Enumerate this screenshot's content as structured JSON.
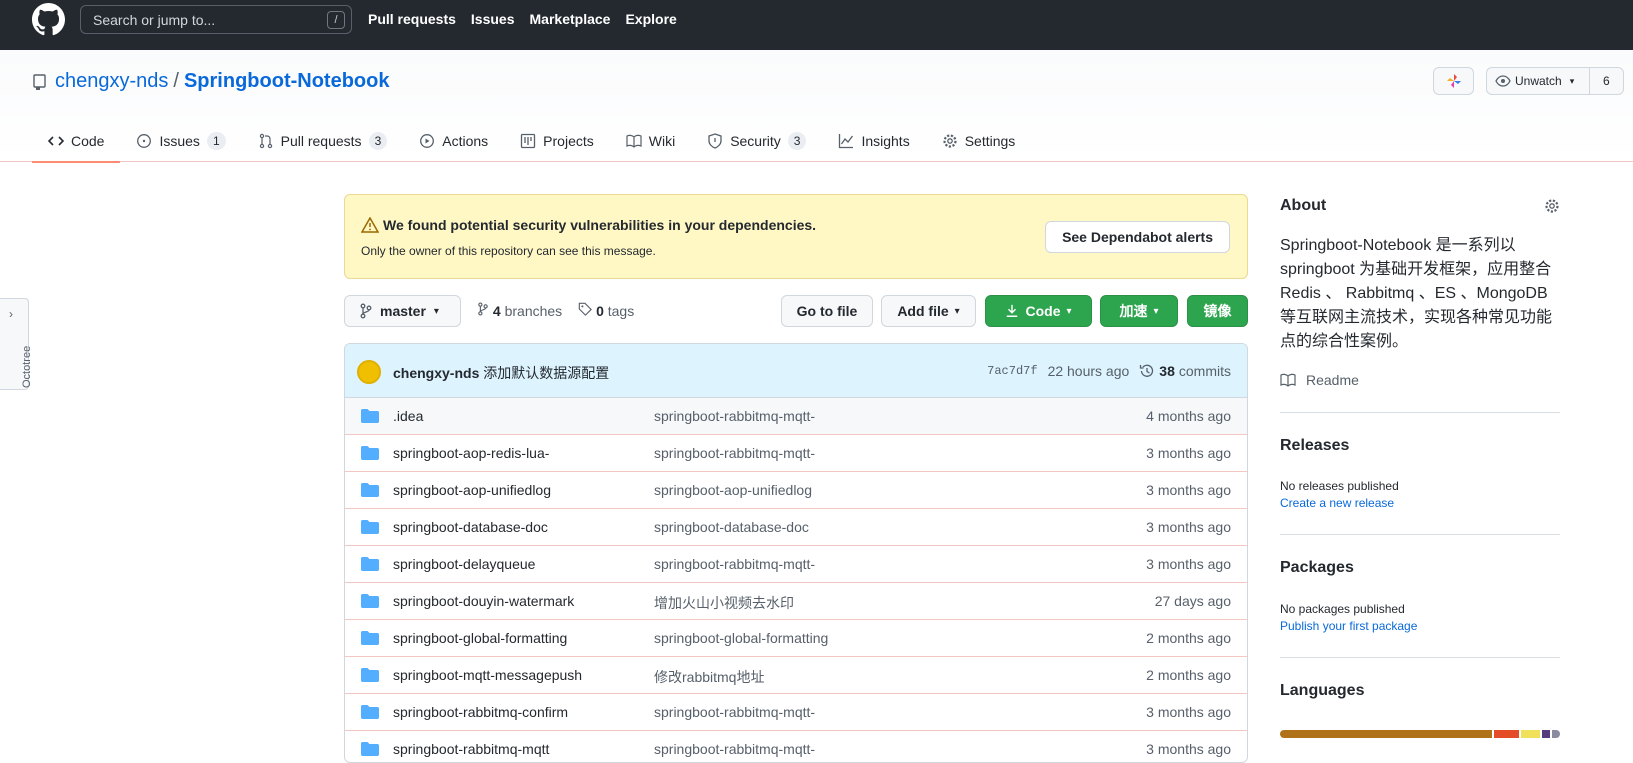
{
  "header": {
    "search_placeholder": "Search or jump to...",
    "search_shortcut": "/",
    "nav": [
      "Pull requests",
      "Issues",
      "Marketplace",
      "Explore"
    ]
  },
  "repo": {
    "owner": "chengxy-nds",
    "separator": "/",
    "name": "Springboot-Notebook",
    "watch_label": "Unwatch",
    "watch_count": "6"
  },
  "tabs": [
    {
      "label": "Code",
      "icon": "code-icon"
    },
    {
      "label": "Issues",
      "icon": "issue-icon",
      "count": "1"
    },
    {
      "label": "Pull requests",
      "icon": "pull-request-icon",
      "count": "3"
    },
    {
      "label": "Actions",
      "icon": "play-icon"
    },
    {
      "label": "Projects",
      "icon": "project-icon"
    },
    {
      "label": "Wiki",
      "icon": "book-icon"
    },
    {
      "label": "Security",
      "icon": "shield-icon",
      "count": "3"
    },
    {
      "label": "Insights",
      "icon": "graph-icon"
    },
    {
      "label": "Settings",
      "icon": "gear-icon"
    }
  ],
  "octotree": {
    "label": "Octotree"
  },
  "alert": {
    "title": "We found potential security vulnerabilities in your dependencies.",
    "subtitle": "Only the owner of this repository can see this message.",
    "button": "See Dependabot alerts"
  },
  "branch": {
    "name": "master",
    "branches_count": "4",
    "branches_label": "branches",
    "tags_count": "0",
    "tags_label": "tags"
  },
  "actions": {
    "go_to_file": "Go to file",
    "add_file": "Add file",
    "code": "Code",
    "accelerate": "加速",
    "mirror": "镜像"
  },
  "commit": {
    "author": "chengxy-nds",
    "message": "添加默认数据源配置",
    "sha": "7ac7d7f",
    "time": "22 hours ago",
    "commits_count": "38",
    "commits_label": "commits"
  },
  "files": [
    {
      "name": ".idea",
      "message": "springboot-rabbitmq-mqtt-",
      "age": "4 months ago"
    },
    {
      "name": "springboot-aop-redis-lua-",
      "message": "springboot-rabbitmq-mqtt-",
      "age": "3 months ago"
    },
    {
      "name": "springboot-aop-unifiedlog",
      "message": "springboot-aop-unifiedlog",
      "age": "3 months ago"
    },
    {
      "name": "springboot-database-doc",
      "message": "springboot-database-doc",
      "age": "3 months ago"
    },
    {
      "name": "springboot-delayqueue",
      "message": "springboot-rabbitmq-mqtt-",
      "age": "3 months ago"
    },
    {
      "name": "springboot-douyin-watermark",
      "message": "增加火山小视频去水印",
      "age": "27 days ago"
    },
    {
      "name": "springboot-global-formatting",
      "message": "springboot-global-formatting",
      "age": "2 months ago"
    },
    {
      "name": "springboot-mqtt-messagepush",
      "message": "修改rabbitmq地址",
      "age": "2 months ago"
    },
    {
      "name": "springboot-rabbitmq-confirm",
      "message": "springboot-rabbitmq-mqtt-",
      "age": "3 months ago"
    },
    {
      "name": "springboot-rabbitmq-mqtt",
      "message": "springboot-rabbitmq-mqtt-",
      "age": "3 months ago"
    }
  ],
  "about": {
    "title": "About",
    "description": "Springboot-Notebook 是一系列以 springboot 为基础开发框架，应用整合 Redis 、 Rabbitmq 、ES 、MongoDB 等互联网主流技术，实现各种常见功能点的综合性案例。",
    "readme": "Readme"
  },
  "releases": {
    "title": "Releases",
    "status": "No releases published",
    "link": "Create a new release"
  },
  "packages": {
    "title": "Packages",
    "status": "No packages published",
    "link": "Publish your first package"
  },
  "languages": {
    "title": "Languages",
    "segments": [
      {
        "color": "#b07219",
        "share": 0.78
      },
      {
        "color": "#e34c26",
        "share": 0.09
      },
      {
        "color": "#f1e05a",
        "share": 0.07
      },
      {
        "color": "#563d7c",
        "share": 0.03
      },
      {
        "color": "#8a8aa0",
        "share": 0.03
      }
    ]
  }
}
